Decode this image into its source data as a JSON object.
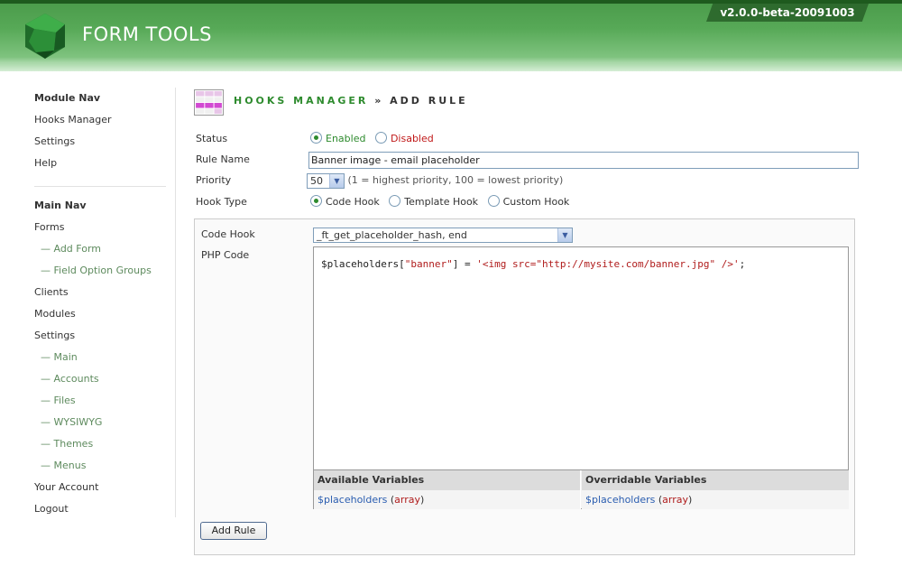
{
  "header": {
    "brand": "FORM TOOLS",
    "version": "v2.0.0-beta-20091003"
  },
  "colors": {
    "header_green": "#57a957",
    "header_dark": "#2e6b2e",
    "title_green": "#2e8b2e",
    "link_green": "#5d8a5d",
    "variable_blue": "#2a5db0",
    "string_red": "#b01c1c"
  },
  "sidebar": {
    "module_nav_title": "Module Nav",
    "module_items": [
      "Hooks Manager",
      "Settings",
      "Help"
    ],
    "main_nav_title": "Main Nav",
    "forms": "Forms",
    "forms_sub": [
      "— Add Form",
      "— Field Option Groups"
    ],
    "clients": "Clients",
    "modules": "Modules",
    "settings": "Settings",
    "settings_sub": [
      "— Main",
      "— Accounts",
      "— Files",
      "— WYSIWYG",
      "— Themes",
      "— Menus"
    ],
    "your_account": "Your Account",
    "logout": "Logout"
  },
  "page": {
    "title_module": "HOOKS MANAGER",
    "title_sep": " » ",
    "title_page": "ADD RULE"
  },
  "form": {
    "status_label": "Status",
    "status_enabled": "Enabled",
    "status_disabled": "Disabled",
    "rule_name_label": "Rule Name",
    "rule_name_value": "Banner image - email placeholder",
    "priority_label": "Priority",
    "priority_value": "50",
    "priority_hint": "(1 = highest priority, 100 = lowest priority)",
    "hook_type_label": "Hook Type",
    "hook_type_code": "Code Hook",
    "hook_type_template": "Template Hook",
    "hook_type_custom": "Custom Hook",
    "code_hook_label": "Code Hook",
    "code_hook_value": "_ft_get_placeholder_hash, end",
    "php_code_label": "PHP Code",
    "code_var": "$placeholders",
    "code_bracket_open": "[",
    "code_key": "\"banner\"",
    "code_bracket_close": "] = ",
    "code_string": "'<img src=\"http://mysite.com/banner.jpg\" />'",
    "code_end": ";",
    "available_vars_header": "Available Variables",
    "overridable_vars_header": "Overridable Variables",
    "available_var_name": "$placeholders",
    "available_var_type": "array",
    "overridable_var_name": "$placeholders",
    "overridable_var_type": "array",
    "submit_label": "Add Rule"
  }
}
